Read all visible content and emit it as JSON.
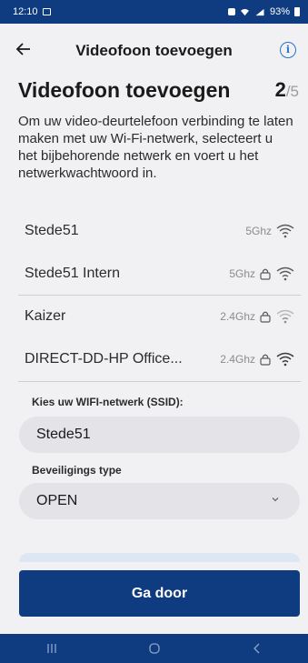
{
  "status_bar": {
    "time": "12:10",
    "battery": "93%"
  },
  "app_bar": {
    "title": "Videofoon toevoegen",
    "back_icon": "arrow-left-icon",
    "info_icon": "info-icon"
  },
  "header": {
    "title": "Videofoon toevoegen",
    "step_current": "2",
    "step_total": "/5"
  },
  "intro": "Om uw video-deurtelefoon verbinding te laten maken met uw Wi-Fi-netwerk, selecteert u het bijbehorende netwerk en voert u het netwerkwachtwoord in.",
  "networks": [
    {
      "name": "Stede51",
      "band": "5Ghz",
      "locked": false
    },
    {
      "name": "Stede51 Intern",
      "band": "5Ghz",
      "locked": true
    },
    {
      "name": "Kaizer",
      "band": "2.4Ghz",
      "locked": true
    },
    {
      "name": "DIRECT-DD-HP Office...",
      "band": "2.4Ghz",
      "locked": true
    }
  ],
  "ssid": {
    "label": "Kies uw WIFI-netwerk (SSID):",
    "value": "Stede51"
  },
  "security": {
    "label": "Beveiligings type",
    "value": "OPEN"
  },
  "cta": {
    "label": "Ga door"
  },
  "colors": {
    "primary": "#0f3c80",
    "field_bg": "#e4e4e8",
    "page_bg": "#f1f1f3"
  }
}
